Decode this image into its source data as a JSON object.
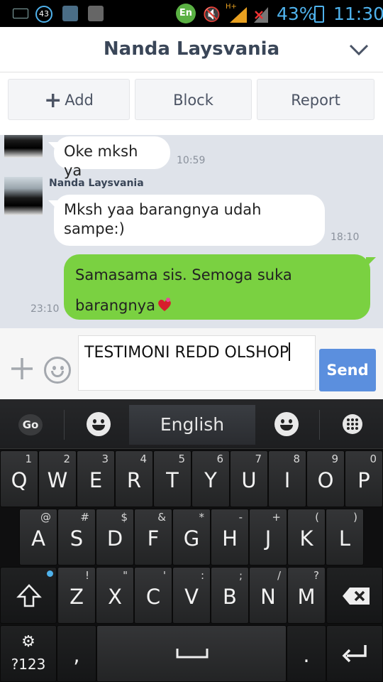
{
  "status_bar": {
    "badge_number": "43",
    "input_indicator": "En",
    "network_type": "H+",
    "battery_percent": "43%",
    "time": "11:30",
    "icons": [
      "keyboard-icon",
      "notification-badge-icon",
      "app-icon",
      "bbm-icon",
      "language-icon",
      "mute-icon",
      "signal-icon",
      "signal-icon",
      "battery-icon"
    ]
  },
  "header": {
    "title": "Nanda Laysvania",
    "collapse_icon": "chevron-down-icon"
  },
  "actions": {
    "add_label": "Add",
    "block_label": "Block",
    "report_label": "Report"
  },
  "messages": [
    {
      "direction": "incoming",
      "sender": "",
      "text": "Oke mksh ya",
      "time": "10:59"
    },
    {
      "direction": "incoming",
      "sender": "Nanda Laysvania",
      "text": "Mksh yaa barangnya udah sampe:)",
      "time": "18:10"
    },
    {
      "direction": "outgoing",
      "text": "Samasama sis. Semoga suka barangnya",
      "sticker": "heart-icon",
      "time": "23:10"
    }
  ],
  "input": {
    "value": "TESTIMONI REDD OLSHOP",
    "send_label": "Send"
  },
  "keyboard": {
    "logo": "Go",
    "language": "English",
    "rows": [
      [
        {
          "main": "Q",
          "alt": "1"
        },
        {
          "main": "W",
          "alt": "2"
        },
        {
          "main": "E",
          "alt": "3"
        },
        {
          "main": "R",
          "alt": "4"
        },
        {
          "main": "T",
          "alt": "5"
        },
        {
          "main": "Y",
          "alt": "6"
        },
        {
          "main": "U",
          "alt": "7"
        },
        {
          "main": "I",
          "alt": "8"
        },
        {
          "main": "O",
          "alt": "9"
        },
        {
          "main": "P",
          "alt": "0"
        }
      ],
      [
        {
          "main": "A",
          "alt": "@"
        },
        {
          "main": "S",
          "alt": "#"
        },
        {
          "main": "D",
          "alt": "$"
        },
        {
          "main": "F",
          "alt": "&"
        },
        {
          "main": "G",
          "alt": "*"
        },
        {
          "main": "H",
          "alt": "-"
        },
        {
          "main": "J",
          "alt": "+"
        },
        {
          "main": "K",
          "alt": "("
        },
        {
          "main": "L",
          "alt": ")"
        }
      ],
      [
        {
          "main": "Z",
          "alt": "!"
        },
        {
          "main": "X",
          "alt": "\""
        },
        {
          "main": "C",
          "alt": "'"
        },
        {
          "main": "V",
          "alt": ":"
        },
        {
          "main": "B",
          "alt": ";"
        },
        {
          "main": "N",
          "alt": "/"
        },
        {
          "main": "M",
          "alt": "?"
        }
      ]
    ],
    "symbols_label": "?123",
    "comma_label": ",",
    "period_label": "."
  }
}
